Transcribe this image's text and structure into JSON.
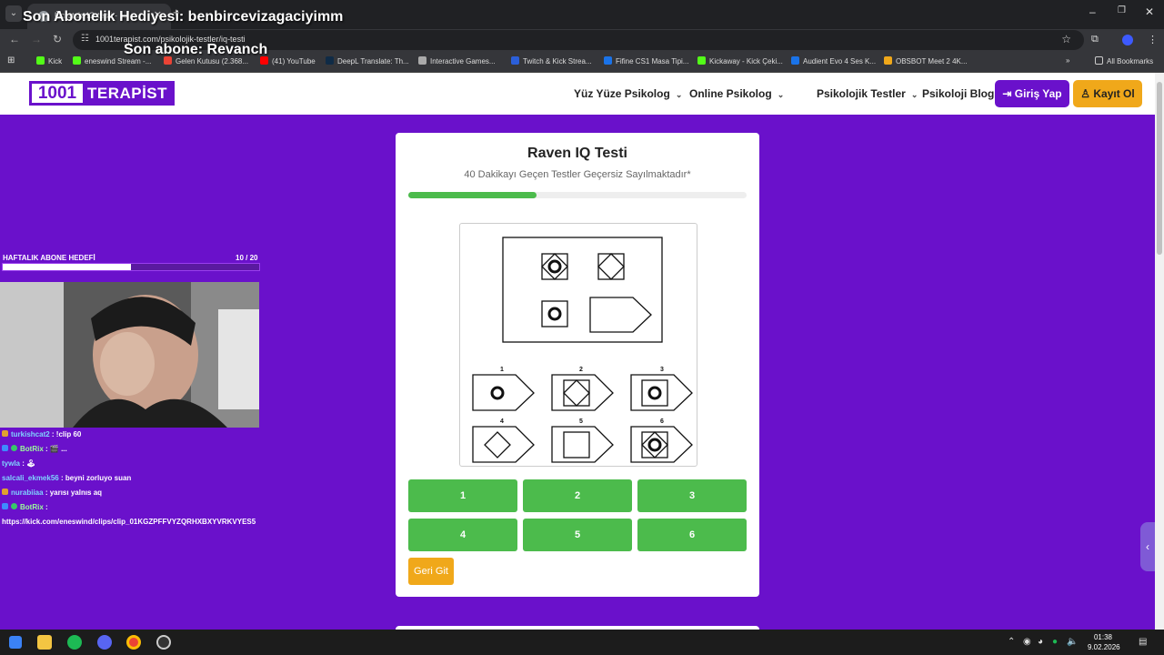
{
  "stream_overlay": {
    "gift_banner": "Son Abonelik Hediyesi: benbircevizagaciyimm",
    "last_sub": "Son abone: Revanch",
    "weekly_goal_label": "HAFTALIK ABONE HEDEFİ",
    "weekly_goal_current": "10",
    "weekly_goal_target": "/ 20",
    "weekly_goal_progress": 0.5
  },
  "browser": {
    "tab_title": "Ücretsiz IQ testi - ...",
    "url": "1001terapist.com/psikolojik-testler/iq-testi",
    "bookmarks": [
      {
        "label": "Kick",
        "color": "#53fc18"
      },
      {
        "label": "eneswind Stream -...",
        "color": "#53fc18"
      },
      {
        "label": "Gelen Kutusu (2.368...",
        "color": "#ea4335"
      },
      {
        "label": "(41) YouTube",
        "color": "#ff0000"
      },
      {
        "label": "DeepL Translate: Th...",
        "color": "#0f2b46"
      },
      {
        "label": "Interactive Games...",
        "color": "#aaaaaa"
      },
      {
        "label": "Twitch & Kick Strea...",
        "color": "#2b5fd9"
      },
      {
        "label": "Fifine CS1 Masa Tipi...",
        "color": "#1a73e8"
      },
      {
        "label": "Kickaway - Kick Çeki...",
        "color": "#53fc18"
      },
      {
        "label": "Audient Evo 4 Ses K...",
        "color": "#1a73e8"
      },
      {
        "label": "OBSBOT Meet 2 4K...",
        "color": "#f0a81a"
      }
    ],
    "all_bookmarks": "All Bookmarks"
  },
  "site": {
    "logo_num": "1001",
    "logo_word": "TERAPİST",
    "nav": [
      {
        "label": "Yüz Yüze Psikolog",
        "caret": true
      },
      {
        "label": "Online Psikolog",
        "caret": true
      },
      {
        "label": "Psikolojik Testler",
        "caret": true
      },
      {
        "label": "Psikoloji Blog",
        "caret": false
      }
    ],
    "login": "Giriş Yap",
    "register": "Kayıt Ol",
    "accent": "#6a11cb",
    "orange": "#f0a81a",
    "green": "#4cbb4c"
  },
  "quiz": {
    "title": "Raven IQ Testi",
    "subtitle": "40 Dakikayı Geçen Testler Geçersiz Sayılmaktadır*",
    "progress": 0.38,
    "option_labels": [
      "1",
      "2",
      "3",
      "4",
      "5",
      "6"
    ],
    "answers": [
      "1",
      "2",
      "3",
      "4",
      "5",
      "6"
    ],
    "back": "Geri Git"
  },
  "chat": [
    {
      "user": "turkishcat2",
      "msg": ": !clip 60",
      "badge": "orange"
    },
    {
      "user": "BotRix",
      "msg": ": 🎬 ...",
      "badge": "blue"
    },
    {
      "user": "tywla",
      "msg": ": 🕹",
      "badge": ""
    },
    {
      "user": "salcali_ekmek56",
      "msg": ": beyni zorluyo suan",
      "badge": ""
    },
    {
      "user": "nurabiiaa",
      "msg": ": yarısı yalnıs aq",
      "badge": "orange"
    },
    {
      "user": "BotRix",
      "msg": ":",
      "badge": "blue"
    },
    {
      "user": "",
      "msg": "https://kick.com/eneswind/clips/clip_01KGZPFFVYZQRHXBXYVRKVYES5",
      "badge": ""
    }
  ],
  "taskbar": {
    "time": "01:38",
    "date": "9.02.2026"
  }
}
